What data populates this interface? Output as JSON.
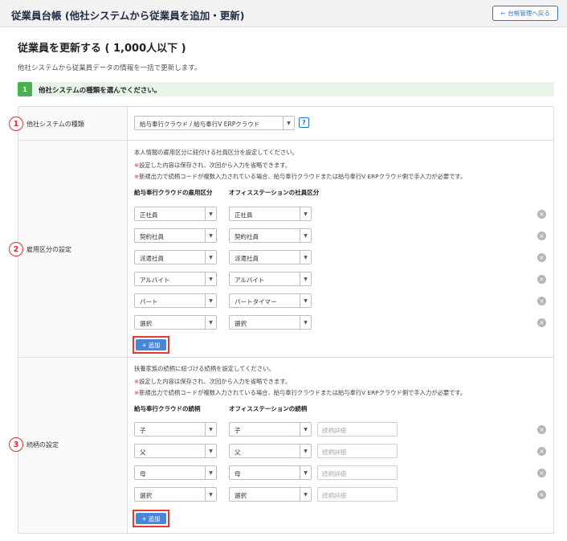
{
  "header": {
    "title": "従業員台帳 (他社システムから従業員を追加・更新)",
    "back_label": "台帳管理へ戻る",
    "back_icon": "arrow-left-icon"
  },
  "page": {
    "title": "従業員を更新する ( 1,000人以下 )",
    "description": "他社システムから従業員データの情報を一括で更新します。"
  },
  "step": {
    "number": "1",
    "text": "他社システムの種類を選んでください。"
  },
  "sections": {
    "system": {
      "num": "1",
      "label": "他社システムの種類",
      "selected": "給与奉行クラウド / 給与奉行V ERPクラウド",
      "help": "?"
    },
    "employment": {
      "num": "2",
      "label": "雇用区分の設定",
      "note": "本人情報の雇用区分に紐付ける社員区分を設定してください。",
      "warn1_mark": "※",
      "warn1": "設定した内容は保存され、次回から入力を省略できます。",
      "warn2_mark": "※",
      "warn2": "新規出力で続柄コードが複数入力されている場合、給与奉行クラウドまたは給与奉行V ERPクラウド側で手入力が必要です。",
      "col_left": "給与奉行クラウドの雇用区分",
      "col_right": "オフィスステーションの社員区分",
      "rows": [
        {
          "left": "正社員",
          "right": "正社員"
        },
        {
          "left": "契約社員",
          "right": "契約社員"
        },
        {
          "left": "派遣社員",
          "right": "派遣社員"
        },
        {
          "left": "アルバイト",
          "right": "アルバイト"
        },
        {
          "left": "パート",
          "right": "パートタイマー"
        },
        {
          "left": "選択",
          "right": "選択"
        }
      ],
      "add_label": "追加"
    },
    "relation": {
      "num": "3",
      "label": "続柄の設定",
      "note": "扶養家族の続柄に紐づける続柄を設定してください。",
      "warn1_mark": "※",
      "warn1": "設定した内容は保存され、次回から入力を省略できます。",
      "warn2_mark": "※",
      "warn2": "新規出力で続柄コードが複数入力されている場合、給与奉行クラウドまたは給与奉行V ERPクラウド側で手入力が必要です。",
      "col_left": "給与奉行クラウドの続柄",
      "col_right": "オフィスステーションの続柄",
      "detail_placeholder": "続柄詳細",
      "rows": [
        {
          "left": "子",
          "right": "子"
        },
        {
          "left": "父",
          "right": "父"
        },
        {
          "left": "母",
          "right": "母"
        },
        {
          "left": "選択",
          "right": "選択"
        }
      ],
      "add_label": "追加"
    }
  },
  "colors": {
    "accent": "#2d74c8",
    "step_green": "#4caf50",
    "highlight_red": "#e53935",
    "add_button": "#4a86d8"
  }
}
